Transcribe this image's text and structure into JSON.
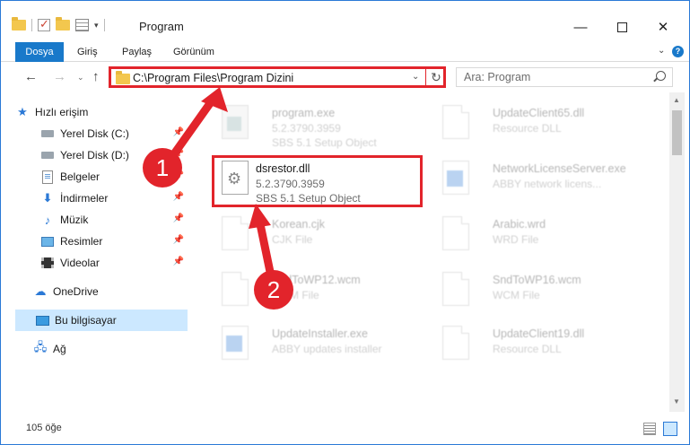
{
  "window": {
    "title": "Program",
    "controls": {
      "minimize": "—",
      "maximize": "",
      "close": "✕"
    }
  },
  "ribbon": {
    "tabs": [
      "Dosya",
      "Giriş",
      "Paylaş",
      "Görünüm"
    ]
  },
  "nav": {
    "address": "C:\\Program Files\\Program Dizini",
    "search_placeholder": "Ara: Program"
  },
  "sidebar": {
    "items": [
      {
        "label": "Hızlı erişim",
        "icon": "star-icon"
      },
      {
        "label": "Yerel Disk (C:)",
        "icon": "drive-icon",
        "pinned": true
      },
      {
        "label": "Yerel Disk (D:)",
        "icon": "drive-icon",
        "pinned": true
      },
      {
        "label": "Belgeler",
        "icon": "documents-icon",
        "pinned": true
      },
      {
        "label": "İndirmeler",
        "icon": "download-icon",
        "pinned": true
      },
      {
        "label": "Müzik",
        "icon": "music-icon",
        "pinned": true
      },
      {
        "label": "Resimler",
        "icon": "pictures-icon",
        "pinned": true
      },
      {
        "label": "Videolar",
        "icon": "videos-icon",
        "pinned": true
      },
      {
        "label": "OneDrive",
        "icon": "cloud-icon"
      },
      {
        "label": "Bu bilgisayar",
        "icon": "computer-icon",
        "selected": true
      },
      {
        "label": "Ağ",
        "icon": "network-icon"
      }
    ]
  },
  "files": [
    {
      "name": "program.exe",
      "line2": "5.2.3790.3959",
      "line3": "SBS 5.1 Setup Object",
      "icon": "exe-file-icon",
      "blurred": true
    },
    {
      "name": "UpdateClient65.dll",
      "line2": "Resource DLL",
      "line3": "",
      "icon": "document-file-icon",
      "blurred": true
    },
    {
      "name": "dsrestor.dll",
      "line2": "5.2.3790.3959",
      "line3": "SBS 5.1 Setup Object",
      "icon": "dll-file-icon",
      "blurred": false
    },
    {
      "name": "NetworkLicenseServer.exe",
      "line2": "ABBY network licens...",
      "line3": "",
      "icon": "app-file-icon",
      "blurred": true
    },
    {
      "name": "Korean.cjk",
      "line2": "CJK File",
      "line3": "",
      "icon": "document-file-icon",
      "blurred": true
    },
    {
      "name": "Arabic.wrd",
      "line2": "WRD File",
      "line3": "",
      "icon": "document-file-icon",
      "blurred": true
    },
    {
      "name": "SndToWP12.wcm",
      "line2": "WCM File",
      "line3": "",
      "icon": "document-file-icon",
      "blurred": true
    },
    {
      "name": "SndToWP16.wcm",
      "line2": "WCM File",
      "line3": "",
      "icon": "document-file-icon",
      "blurred": true
    },
    {
      "name": "UpdateInstaller.exe",
      "line2": "ABBY updates installer",
      "line3": "",
      "icon": "app-file-icon",
      "blurred": true
    },
    {
      "name": "UpdateClient19.dll",
      "line2": "Resource DLL",
      "line3": "",
      "icon": "document-file-icon",
      "blurred": true
    }
  ],
  "status": {
    "item_count": "105 öğe"
  },
  "annotations": {
    "step1": "1",
    "step2": "2",
    "color": "#e2242b"
  },
  "colors": {
    "accent": "#1979ca",
    "selection": "#cce8ff",
    "highlight": "#e2242b"
  }
}
